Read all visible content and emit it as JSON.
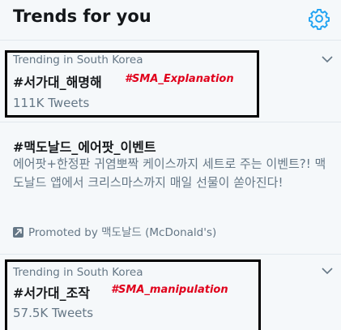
{
  "header": {
    "title": "Trends for you",
    "settings_icon": "gear-icon"
  },
  "trends": [
    {
      "context": "Trending in South Korea",
      "hashtag": "#서가대_해명해",
      "annotation": "#SMA_Explanation",
      "count": "111K Tweets"
    },
    {
      "hashtag": "#맥도날드_에어팟_이벤트",
      "description": "에어팟+한정판 귀염뽀짝 케이스까지 세트로 주는 이벤트?! 맥도날드 앱에서 크리스마스까지 매일 선물이 쏟아진다!",
      "promoted": "Promoted by 맥도날드 (McDonald's)"
    },
    {
      "context": "Trending in South Korea",
      "hashtag": "#서가대_조작",
      "annotation": "#SMA_manipulation",
      "count": "57.5K Tweets"
    }
  ],
  "colors": {
    "accent": "#1da1f2",
    "secondary_text": "#657786",
    "annotation": "#e0001b",
    "highlight_box": "#000000"
  }
}
